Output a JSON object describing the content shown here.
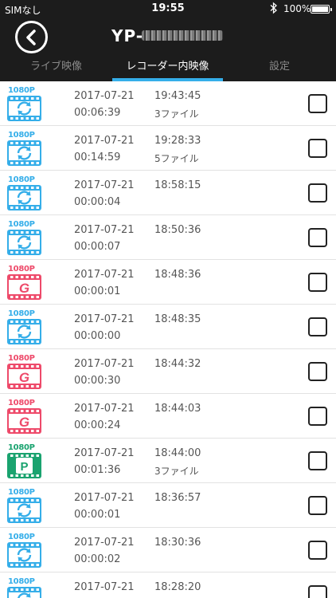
{
  "status_bar": {
    "carrier": "SIMなし",
    "time": "19:55",
    "battery": "100%",
    "battery_level": 1.0
  },
  "header": {
    "title": "YP-"
  },
  "tabs": [
    {
      "label": "ライブ映像",
      "active": false
    },
    {
      "label": "レコーダー内映像",
      "active": true
    },
    {
      "label": "設定",
      "active": false
    }
  ],
  "colors": {
    "accent": "#35aee9",
    "normal": "#35aee9",
    "event": "#ee4a6a",
    "parking": "#1aa36f"
  },
  "recordings": [
    {
      "resolution": "1080P",
      "type": "normal",
      "icon": "loop-film-icon",
      "date": "2017-07-21",
      "time": "19:43:45",
      "duration": "00:06:39",
      "files": "3ファイル"
    },
    {
      "resolution": "1080P",
      "type": "normal",
      "icon": "loop-film-icon",
      "date": "2017-07-21",
      "time": "19:28:33",
      "duration": "00:14:59",
      "files": "5ファイル"
    },
    {
      "resolution": "1080P",
      "type": "normal",
      "icon": "loop-film-icon",
      "date": "2017-07-21",
      "time": "18:58:15",
      "duration": "00:00:04",
      "files": ""
    },
    {
      "resolution": "1080P",
      "type": "normal",
      "icon": "loop-film-icon",
      "date": "2017-07-21",
      "time": "18:50:36",
      "duration": "00:00:07",
      "files": ""
    },
    {
      "resolution": "1080P",
      "type": "event",
      "icon": "g-sensor-film-icon",
      "date": "2017-07-21",
      "time": "18:48:36",
      "duration": "00:00:01",
      "files": ""
    },
    {
      "resolution": "1080P",
      "type": "normal",
      "icon": "loop-film-icon",
      "date": "2017-07-21",
      "time": "18:48:35",
      "duration": "00:00:00",
      "files": ""
    },
    {
      "resolution": "1080P",
      "type": "event",
      "icon": "g-sensor-film-icon",
      "date": "2017-07-21",
      "time": "18:44:32",
      "duration": "00:00:30",
      "files": ""
    },
    {
      "resolution": "1080P",
      "type": "event",
      "icon": "g-sensor-film-icon",
      "date": "2017-07-21",
      "time": "18:44:03",
      "duration": "00:00:24",
      "files": ""
    },
    {
      "resolution": "1080P",
      "type": "parking",
      "icon": "parking-film-icon",
      "date": "2017-07-21",
      "time": "18:44:00",
      "duration": "00:01:36",
      "files": "3ファイル"
    },
    {
      "resolution": "1080P",
      "type": "normal",
      "icon": "loop-film-icon",
      "date": "2017-07-21",
      "time": "18:36:57",
      "duration": "00:00:01",
      "files": ""
    },
    {
      "resolution": "1080P",
      "type": "normal",
      "icon": "loop-film-icon",
      "date": "2017-07-21",
      "time": "18:30:36",
      "duration": "00:00:02",
      "files": ""
    },
    {
      "resolution": "1080P",
      "type": "normal",
      "icon": "loop-film-icon",
      "date": "2017-07-21",
      "time": "18:28:20",
      "duration": "",
      "files": ""
    }
  ]
}
